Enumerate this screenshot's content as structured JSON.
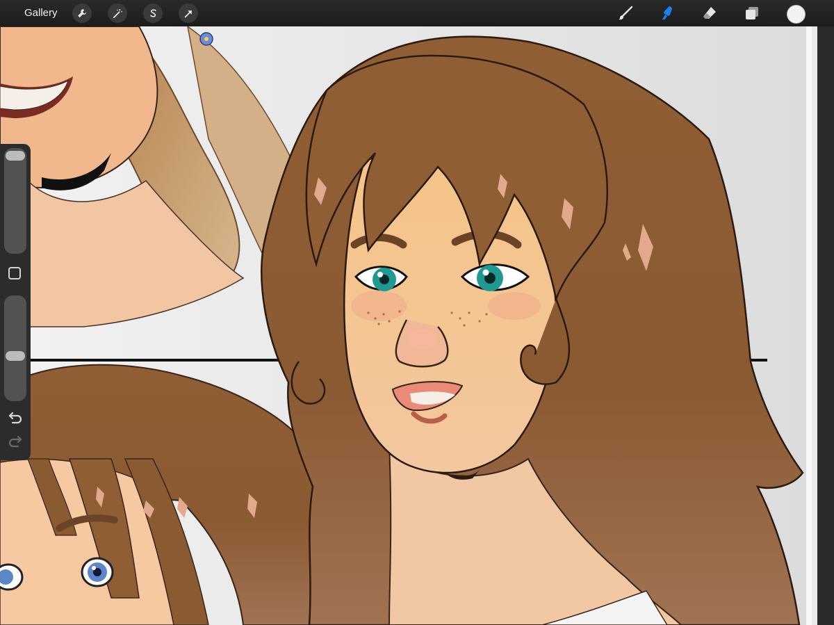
{
  "topbar": {
    "gallery_label": "Gallery",
    "left_tools": [
      "wrench-icon",
      "magic-wand-icon",
      "selection-s-icon",
      "arrow-transform-icon"
    ],
    "right_tools": [
      "brush-icon",
      "smudge-icon",
      "eraser-icon",
      "layers-icon"
    ],
    "active_tool": "smudge-icon",
    "current_color": "#f2f2f2"
  },
  "colors": {
    "accent": "#1f7ff2",
    "toolbar_bg": "#1e1e1e",
    "canvas_bg": "#e7e7e7",
    "hair": "#8a5a33",
    "skin": "#f1c08f",
    "eyes": "#1e9a91"
  },
  "sidebar": {
    "brush_size_level": 0.05,
    "opacity_level": 0.6
  }
}
